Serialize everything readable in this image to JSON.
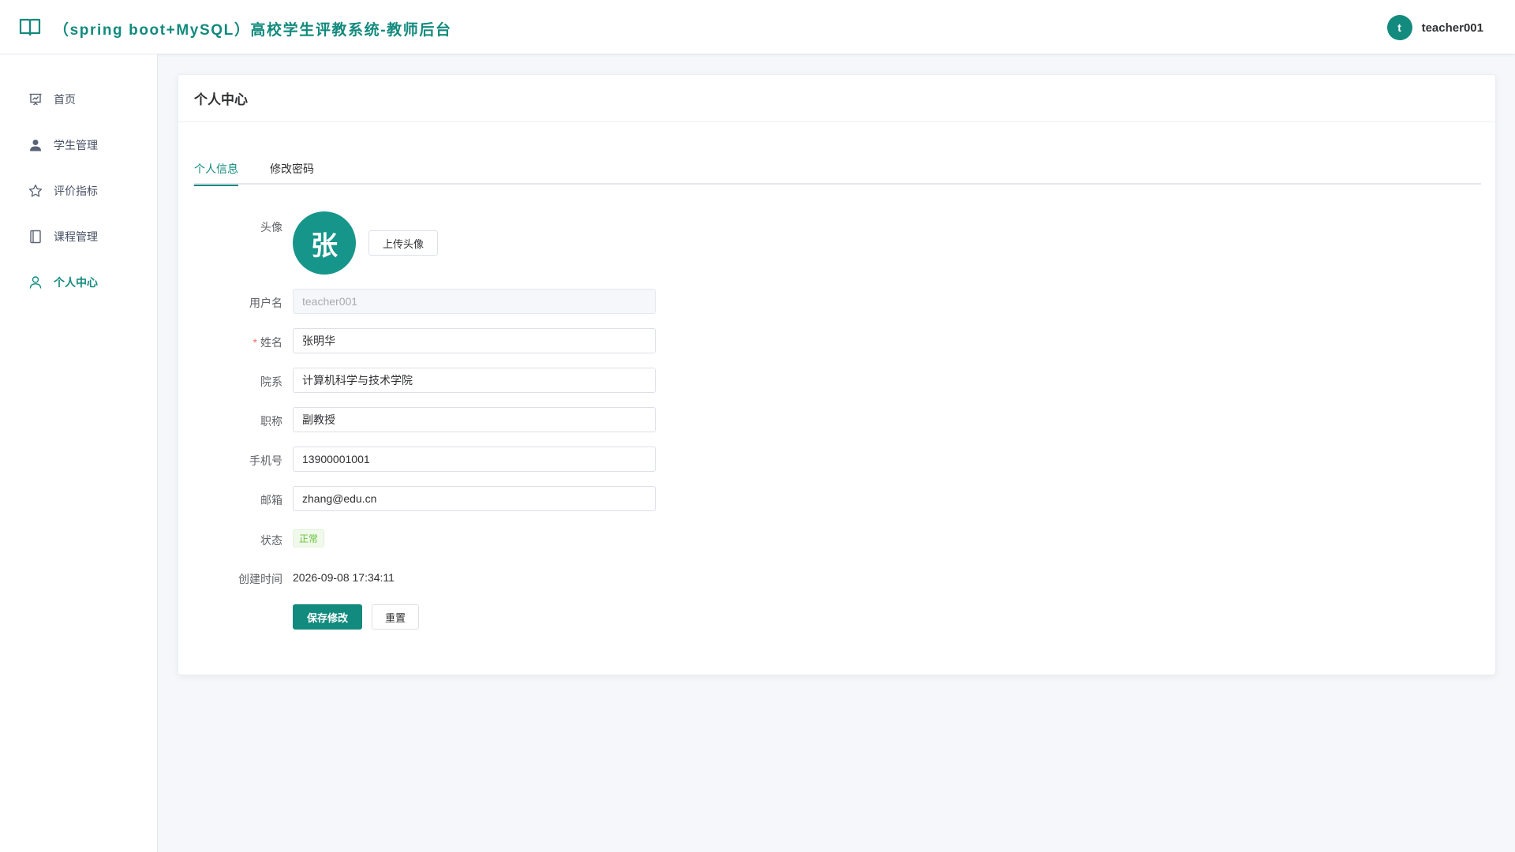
{
  "header": {
    "title": "（spring boot+MySQL）高校学生评教系统-教师后台",
    "logo_icon": "book-open-icon",
    "user": {
      "avatar_letter": "t",
      "name": "teacher001"
    }
  },
  "sidebar": {
    "items": [
      {
        "label": "首页",
        "icon": "presentation-chart-icon",
        "active": false
      },
      {
        "label": "学生管理",
        "icon": "user-icon",
        "active": false
      },
      {
        "label": "评价指标",
        "icon": "star-icon",
        "active": false
      },
      {
        "label": "课程管理",
        "icon": "notebook-icon",
        "active": false
      },
      {
        "label": "个人中心",
        "icon": "user-outline-icon",
        "active": true
      }
    ]
  },
  "card": {
    "title": "个人中心",
    "tabs": [
      {
        "label": "个人信息",
        "active": true
      },
      {
        "label": "修改密码",
        "active": false
      }
    ]
  },
  "form": {
    "avatar": {
      "label": "头像",
      "letter": "张",
      "upload_label": "上传头像"
    },
    "username": {
      "label": "用户名",
      "value": "teacher001"
    },
    "name": {
      "label": "姓名",
      "required": "*",
      "value": "张明华"
    },
    "department": {
      "label": "院系",
      "value": "计算机科学与技术学院"
    },
    "title": {
      "label": "职称",
      "value": "副教授"
    },
    "phone": {
      "label": "手机号",
      "value": "13900001001"
    },
    "email": {
      "label": "邮箱",
      "value": "zhang@edu.cn"
    },
    "status": {
      "label": "状态",
      "value": "正常"
    },
    "created": {
      "label": "创建时间",
      "value": "2026-09-08 17:34:11"
    },
    "save_label": "保存修改",
    "reset_label": "重置"
  },
  "colors": {
    "accent": "#138a7e",
    "success": "#67c23a",
    "required": "#f56c6c"
  }
}
